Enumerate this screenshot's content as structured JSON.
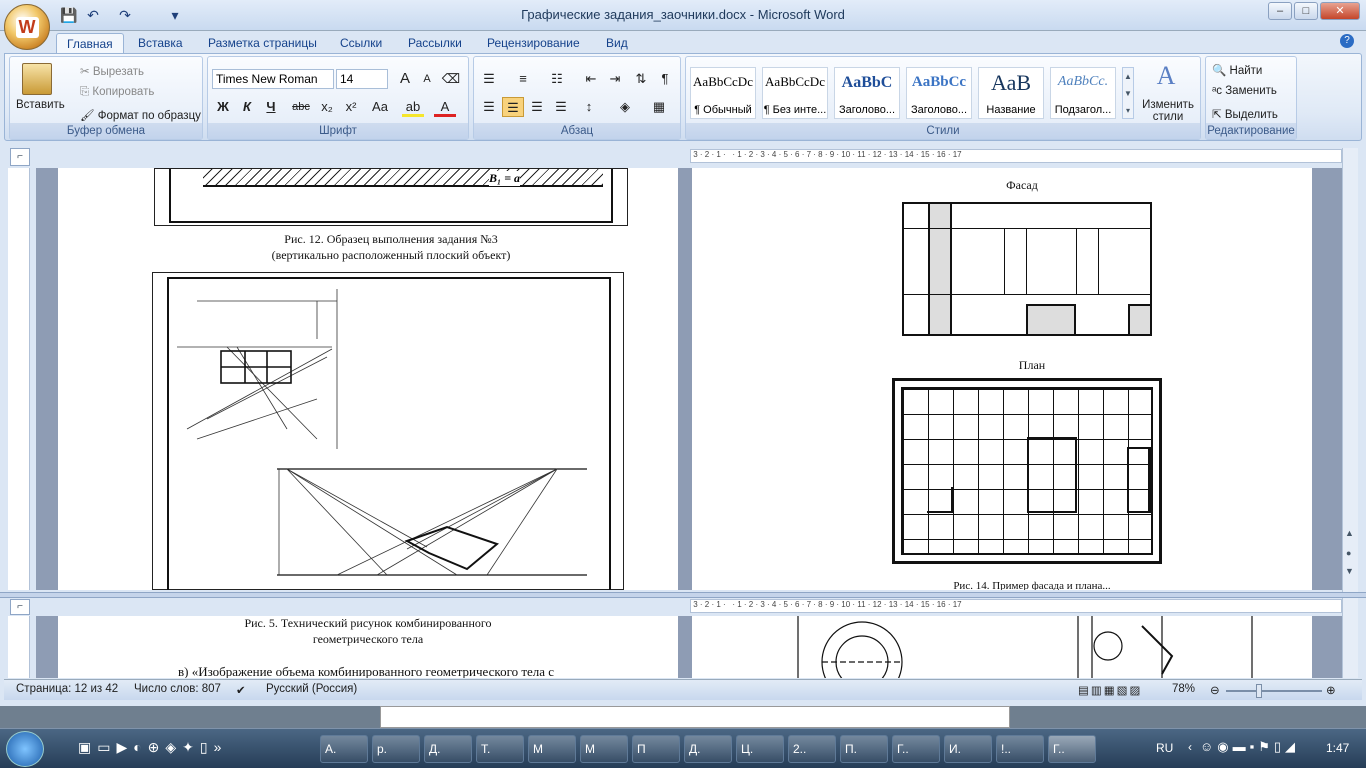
{
  "window": {
    "title": "Графические задания_заочники.docx - Microsoft Word",
    "logo_text": "W",
    "controls": {
      "minimize": "–",
      "maximize": "□",
      "close": "✕"
    }
  },
  "qat": {
    "save_icon": "💾",
    "undo_icon": "↶",
    "redo_icon": "↷",
    "customize": "▾"
  },
  "tabs": [
    "Главная",
    "Вставка",
    "Разметка страницы",
    "Ссылки",
    "Рассылки",
    "Рецензирование",
    "Вид"
  ],
  "help_icon": "?",
  "ribbon": {
    "clipboard": {
      "paste": "Вставить",
      "cut": "Вырезать",
      "copy": "Копировать",
      "format_painter": "Формат по образцу",
      "label": "Буфер обмена"
    },
    "font": {
      "name": "Times New Roman",
      "size": "14",
      "bold": "Ж",
      "italic": "К",
      "underline": "Ч",
      "strike": "abc",
      "sub": "x₂",
      "sup": "x²",
      "case": "Aa",
      "grow": "A",
      "shrink": "A",
      "highlight": "ab",
      "color": "A",
      "label": "Шрифт"
    },
    "paragraph": {
      "label": "Абзац"
    },
    "styles": {
      "items": [
        {
          "preview": "AaBbCcDc",
          "name": "¶ Обычный"
        },
        {
          "preview": "AaBbCcDc",
          "name": "¶ Без инте..."
        },
        {
          "preview": "AaBbC",
          "name": "Заголово..."
        },
        {
          "preview": "AaBbCc",
          "name": "Заголово..."
        },
        {
          "preview": "АаВ",
          "name": "Название"
        },
        {
          "preview": "AaBbCc.",
          "name": "Подзагол..."
        }
      ],
      "change": "Изменить стили",
      "label": "Стили"
    },
    "editing": {
      "find": "Найти",
      "replace": "Заменить",
      "select": "Выделить",
      "label": "Редактирование"
    }
  },
  "document": {
    "left_caption_1": "Рис. 12. Образец выполнения задания №3",
    "left_caption_2": "(вертикально расположенный плоский объект)",
    "b1_label": "B₁ = a",
    "right_title_1": "Фасад",
    "right_title_2": "План",
    "right_caption_cut": "Рис. 14. Пример фасада и плана...",
    "lower_caption_1": "Рис. 5. Технический рисунок комбинированного",
    "lower_caption_2": "геометрического тела",
    "lower_text": "в) «Изображение объема комбинированного геометрического тела с"
  },
  "status": {
    "page": "Страница: 12 из 42",
    "words": "Число слов: 807",
    "language": "Русский (Россия)",
    "zoom": "78%"
  },
  "taskbar": {
    "items": [
      "А.",
      "р.",
      "Д.",
      "Т.",
      "М",
      "М",
      "П",
      "Д.",
      "Ц.",
      "2..",
      "П.",
      "Г..",
      "И.",
      "!..",
      "Г.."
    ],
    "lang": "RU",
    "time": "1:47"
  }
}
